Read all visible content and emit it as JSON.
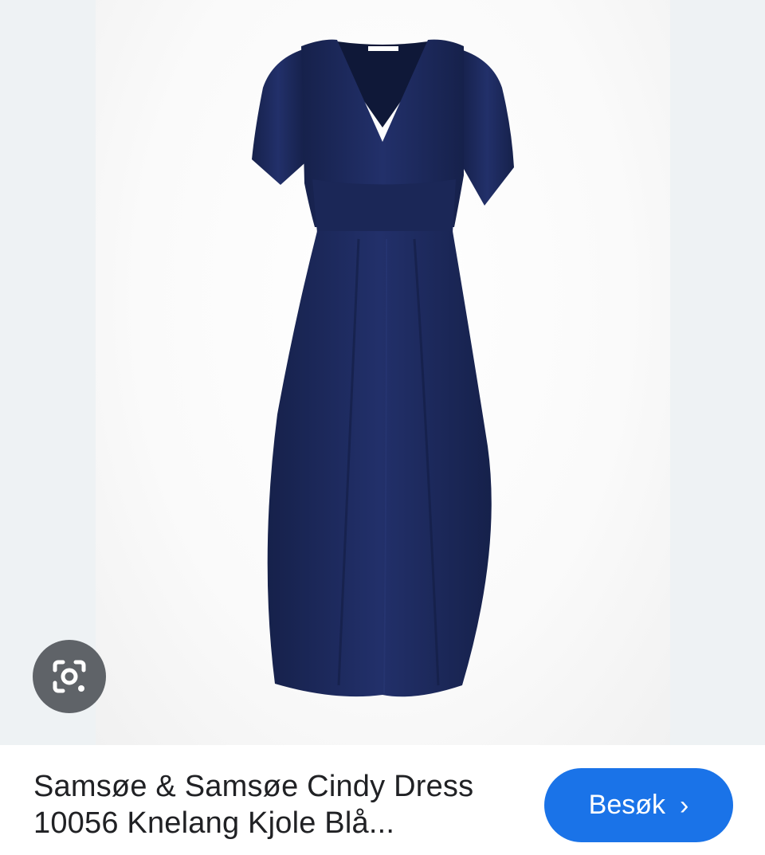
{
  "result": {
    "title_line1": "Samsøe & Samsøe Cindy Dress",
    "title_line2": "10056 Knelang Kjole Blå...",
    "visit_label": "Besøk",
    "visit_icon": "chevron-right-icon"
  },
  "image": {
    "subject": "navy v-neck midi dress",
    "dress_color": "#1d2a5a",
    "lens_icon": "google-lens-icon"
  },
  "colors": {
    "accent": "#1a73e8",
    "lens_bg": "#5f6368",
    "text": "#202124"
  }
}
